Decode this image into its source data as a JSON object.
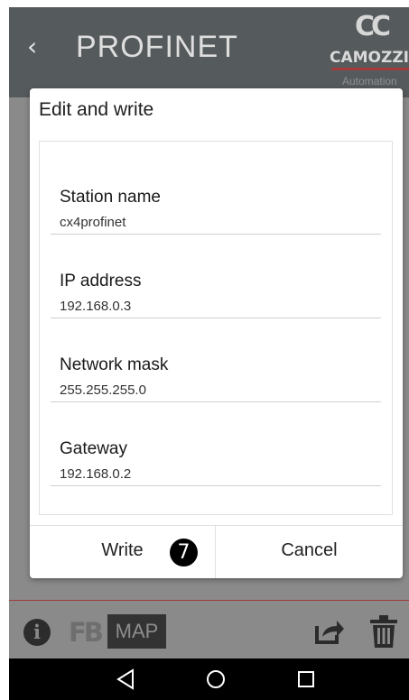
{
  "header": {
    "back_glyph": "‹",
    "title": "PROFINET",
    "logo": {
      "brand": "CAMOZZI",
      "sub": "Automation"
    }
  },
  "dialog": {
    "title": "Edit and write",
    "fields": [
      {
        "label": "Station name",
        "value": "cx4profinet"
      },
      {
        "label": "IP address",
        "value": "192.168.0.3"
      },
      {
        "label": "Network mask",
        "value": "255.255.255.0"
      },
      {
        "label": "Gateway",
        "value": "192.168.0.2"
      }
    ],
    "write_label": "Write",
    "cancel_label": "Cancel",
    "step_badge": "7"
  },
  "toolbar": {
    "info": "i",
    "fb": "FB",
    "map": "MAP"
  },
  "colors": {
    "header_bg": "#555a5c",
    "overlay_bg": "#8a8a8a",
    "accent_red": "#a53a3a"
  },
  "icons": [
    "back-chevron",
    "info-icon",
    "fb-icon",
    "share-icon",
    "trash-icon",
    "nav-back-icon",
    "nav-home-icon",
    "nav-recent-icon"
  ]
}
